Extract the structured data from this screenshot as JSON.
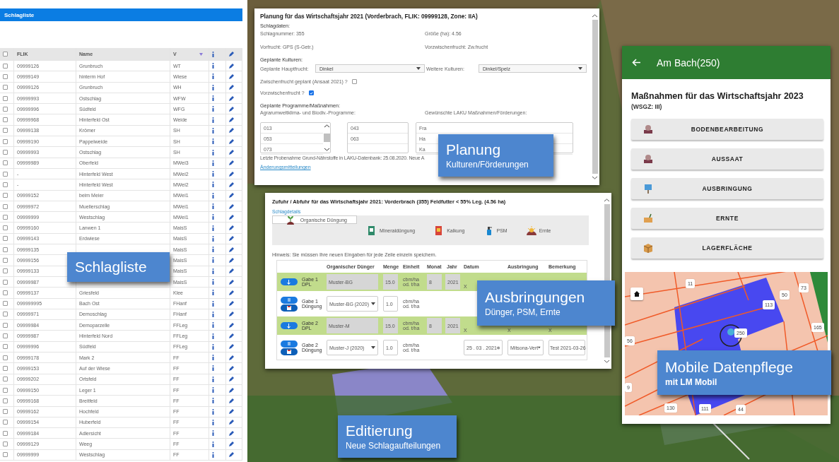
{
  "list_panel": {
    "title": "Schlagliste",
    "all_checked": false,
    "columns": [
      "FLIK",
      "Name",
      "V"
    ],
    "rows": [
      {
        "flik": "09999126",
        "name": "Grunbruch",
        "v": "WT",
        "checked": false
      },
      {
        "flik": "09999149",
        "name": "hinterm Hof",
        "v": "Wiese",
        "checked": false
      },
      {
        "flik": "09999126",
        "name": "Grunbruch",
        "v": "WH",
        "checked": false
      },
      {
        "flik": "09999993",
        "name": "Ostschlag",
        "v": "WFW",
        "checked": false
      },
      {
        "flik": "09999996",
        "name": "Südfeld",
        "v": "WFG",
        "checked": false
      },
      {
        "flik": "09999968",
        "name": "Hinterfeld Ost",
        "v": "Weide",
        "checked": false
      },
      {
        "flik": "09999138",
        "name": "Krömer",
        "v": "SH",
        "checked": false
      },
      {
        "flik": "09999190",
        "name": "Pappelweide",
        "v": "SH",
        "checked": false
      },
      {
        "flik": "09999993",
        "name": "Ostschlag",
        "v": "SH",
        "checked": false
      },
      {
        "flik": "09999989",
        "name": "Oberfeld",
        "v": "MWei3",
        "checked": false
      },
      {
        "flik": "-",
        "name": "Hinterfeld West",
        "v": "MWei2",
        "checked": false
      },
      {
        "flik": "-",
        "name": "Hinterfeld West",
        "v": "MWei2",
        "checked": false
      },
      {
        "flik": "09999152",
        "name": "beim Meier",
        "v": "MWei1",
        "checked": false
      },
      {
        "flik": "09999972",
        "name": "Muellerschlag",
        "v": "MWei1",
        "checked": false
      },
      {
        "flik": "09999999",
        "name": "Westschlag",
        "v": "MWei1",
        "checked": false
      },
      {
        "flik": "09999160",
        "name": "Lanwen 1",
        "v": "MaisS",
        "checked": false
      },
      {
        "flik": "09999143",
        "name": "Erdwiese",
        "v": "MaisS",
        "checked": false
      },
      {
        "flik": "09999135",
        "v": "MaisS",
        "checked": false
      },
      {
        "flik": "09999156",
        "v": "MaisS",
        "checked": false
      },
      {
        "flik": "09999133",
        "v": "MaisS",
        "checked": false
      },
      {
        "flik": "09999987",
        "v": "MaisS",
        "checked": false
      },
      {
        "flik": "09999137",
        "name": "Griesfeld",
        "v": "Klee",
        "checked": false
      },
      {
        "flik": "099999995",
        "name": "Bach Ost",
        "v": "FHanf",
        "checked": false
      },
      {
        "flik": "09999971",
        "name": "Demoschlag",
        "v": "FHanf",
        "checked": false
      },
      {
        "flik": "09999984",
        "name": "Demoparzelle",
        "v": "FFLeg",
        "checked": false
      },
      {
        "flik": "09999987",
        "name": "Hinterfeld Nord",
        "v": "FFLeg",
        "checked": false
      },
      {
        "flik": "09999996",
        "name": "Südfeld",
        "v": "FFLeg",
        "checked": false
      },
      {
        "flik": "09999178",
        "name": "Mark 2",
        "v": "FF",
        "checked": false
      },
      {
        "flik": "09999153",
        "name": "Auf der Wiese",
        "v": "FF",
        "checked": false
      },
      {
        "flik": "09999202",
        "name": "Ortsfeld",
        "v": "FF",
        "checked": false
      },
      {
        "flik": "09999150",
        "name": "Leger 1",
        "v": "FF",
        "checked": false
      },
      {
        "flik": "09999168",
        "name": "Breitfeld",
        "v": "FF",
        "checked": false
      },
      {
        "flik": "09999162",
        "name": "Hochfeld",
        "v": "FF",
        "checked": false
      },
      {
        "flik": "09999154",
        "name": "Huberfeld",
        "v": "FF",
        "checked": false
      },
      {
        "flik": "09999184",
        "name": "Adlersicht",
        "v": "FF",
        "checked": false
      },
      {
        "flik": "09999129",
        "name": "Weeg",
        "v": "FF",
        "checked": false
      },
      {
        "flik": "09999999",
        "name": "Westschlag",
        "v": "FF",
        "checked": false
      }
    ],
    "callout": {
      "title": "Schlagliste"
    }
  },
  "planning_dialog": {
    "title": "Planung für das Wirtschaftsjahr 2021 (Vorderbrach, FLIK: 09999128, Zone: IIA)",
    "section_1": "Schlagdaten:",
    "fields": [
      "Schlagnummer: 355",
      "Größe (ha): 4.56",
      "Vorfrucht: GPS (S-Getr.)",
      "Vorzwischenfrucht: Zw.frucht"
    ],
    "section_2": "Geplante Kulturen:",
    "main_crop": {
      "label": "Geplante Hauptfrucht:",
      "value": "Dinkel"
    },
    "other_crops": {
      "label": "Weitere Kulturen:",
      "value": "Dinkel/Spelz"
    },
    "checks": [
      {
        "label": "Zwischenfrucht geplant (Ansaat 2021) ?",
        "checked": false
      },
      {
        "label": "Vorzwischenfrucht ?",
        "checked": true
      }
    ],
    "section_3": "Geplante Programme/Maßnahmen:",
    "programs_label": "Agrarumweltklima- und Biodiv.-Programme:",
    "laku_label": "Gewünschte LAKU Maßnahmen/Förderungen:",
    "list_1": [
      "013",
      "053",
      "073"
    ],
    "list_2": [
      "043",
      "063"
    ],
    "list_3": [
      "Fra",
      "Ha",
      "Ka"
    ],
    "note": "Letzte Probenahme Grund-Nährstoffe in LAKU-Datenbank: 25.08.2020. Neue A",
    "link": "Änderungsmitteilungen",
    "callout": {
      "title": "Planung",
      "subtitle": "Kulturen/Förderungen"
    }
  },
  "application_dialog": {
    "title": "Zufuhr / Abfuhr für das Wirtschaftsjahr 2021: Vorderbrach (355) Feldfutter < 55% Leg. (4.56 ha)",
    "link": "Schlagdetails",
    "tabs": [
      {
        "label": "Organische Düngung",
        "selected": true
      },
      {
        "label": "Mineraldüngung",
        "selected": false
      },
      {
        "label": "Kalkung",
        "selected": false
      },
      {
        "label": "PSM",
        "selected": false
      },
      {
        "label": "Ernte",
        "selected": false
      }
    ],
    "hint": "Hinweis: Sie müssen Ihre neuen Eingaben für jede Zeile einzeln speichern.",
    "columns": [
      "Organischer Dünger",
      "Menge",
      "Einheit",
      "Monat",
      "Jahr",
      "Datum",
      "Ausbringung",
      "Bemerkung"
    ],
    "rows": [
      {
        "kind": "planned",
        "label_1": "Gabe 1",
        "label_2": "DPL",
        "fertilizer": "Muster-BG",
        "amount": "15.0",
        "unit_1": "cbm/ha",
        "unit_2": "od. t/ha",
        "month": "8",
        "year": "2021",
        "date": "X"
      },
      {
        "kind": "entry",
        "label_1": "Gabe 1",
        "label_2": "Düngung",
        "fertilizer": "Muster-BG (2020)",
        "amount": "1.0",
        "unit_1": "cbm/ha",
        "unit_2": "od. t/ha"
      },
      {
        "kind": "planned",
        "label_1": "Gabe 2",
        "label_2": "DPL",
        "fertilizer": "Muster-M",
        "amount": "15.0",
        "unit_1": "cbm/ha",
        "unit_2": "od. t/ha",
        "month": "8",
        "year": "2021",
        "date": "X",
        "application": "X",
        "remark": "X"
      },
      {
        "kind": "entry",
        "label_1": "Gabe 2",
        "label_2": "Düngung",
        "fertilizer": "Muster-J (2020)",
        "amount": "1.0",
        "unit_1": "cbm/ha",
        "unit_2": "od. t/ha",
        "date": "25 . 03 . 2021",
        "application": "Mitsona-Vert",
        "remark": "Test 2021-03-26"
      }
    ],
    "callout": {
      "title": "Ausbringungen",
      "subtitle": "Dünger, PSM, Ernte"
    }
  },
  "mobile_app": {
    "title": "Am Bach(250)",
    "heading": "Maßnahmen für das Wirtschaftsjahr 2023",
    "subheading": "(WSGZ: III)",
    "actions": [
      {
        "kind": "soil",
        "label": "BODENBEARBEITUNG"
      },
      {
        "kind": "sowing",
        "label": "AUSSAAT"
      },
      {
        "kind": "spreading",
        "label": "AUSBRINGUNG"
      },
      {
        "kind": "harvest",
        "label": "ERNTE"
      },
      {
        "kind": "storage",
        "label": "LAGERFLÄCHE"
      }
    ],
    "map_labels": [
      "11",
      "73",
      "50",
      "113",
      "250",
      "165",
      "56",
      "9",
      "130",
      "111",
      "44"
    ],
    "callout": {
      "title": "Mobile Datenpflege",
      "subtitle": "mit LM Mobil"
    }
  },
  "map": {
    "callout": {
      "title": "Editierung",
      "subtitle": "Neue Schlagaufteilungen"
    }
  }
}
